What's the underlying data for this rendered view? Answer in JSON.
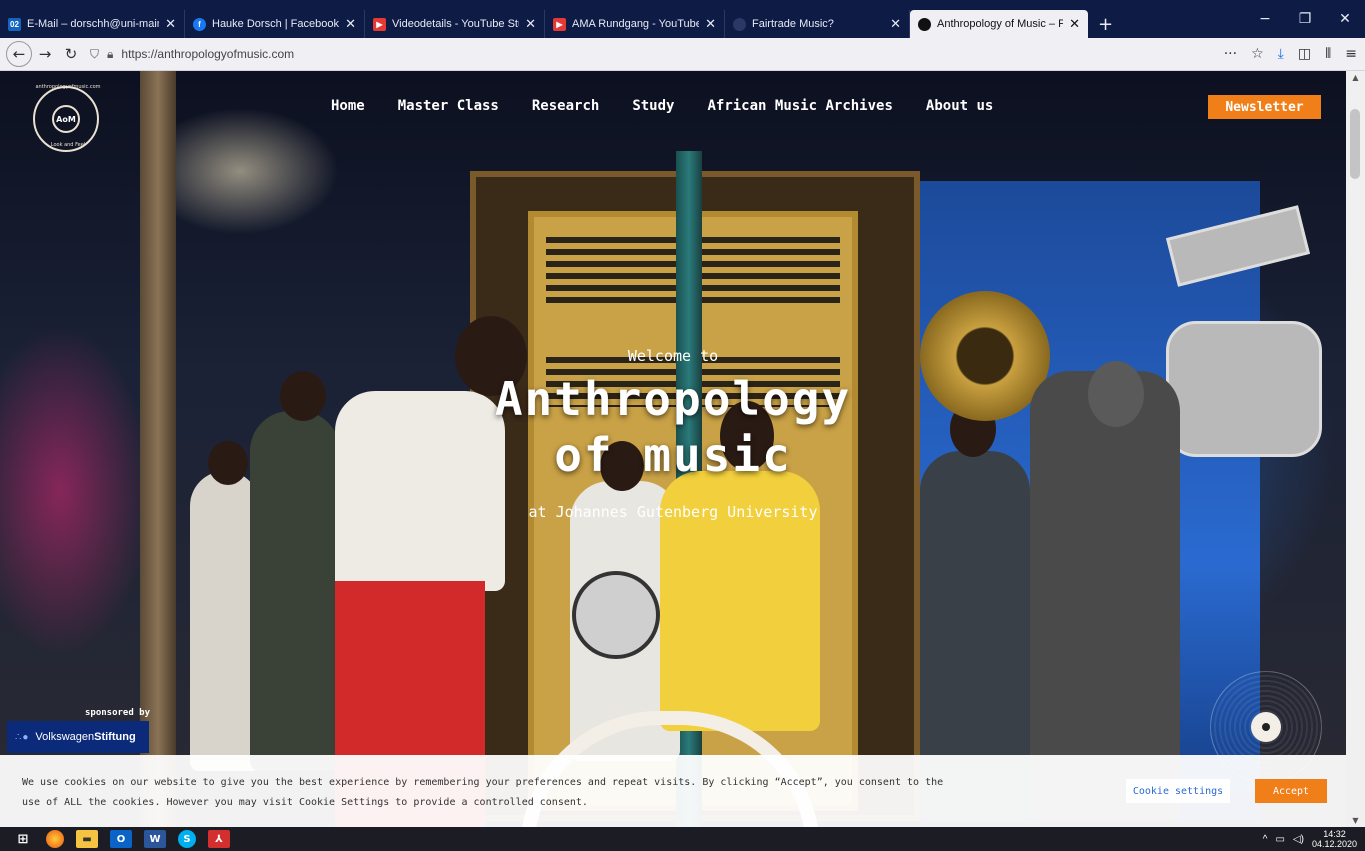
{
  "browser": {
    "tabs": [
      {
        "title": "E-Mail – dorschh@uni-mainz.d",
        "icon": "mail-icon",
        "color": "#1565c0",
        "active": false
      },
      {
        "title": "Hauke Dorsch | Facebook",
        "icon": "facebook-icon",
        "color": "#1877f2",
        "active": false
      },
      {
        "title": "Videodetails - YouTube Studio",
        "icon": "youtube-icon",
        "color": "#e53935",
        "active": false
      },
      {
        "title": "AMA Rundgang - YouTube",
        "icon": "youtube-icon",
        "color": "#e53935",
        "active": false
      },
      {
        "title": "Fairtrade Music?",
        "icon": "globe-icon",
        "color": "#555555",
        "active": false
      },
      {
        "title": "Anthropology of Music – Play",
        "icon": "site-icon",
        "color": "#111111",
        "active": true
      }
    ],
    "url": "https://anthropologyofmusic.com"
  },
  "site": {
    "logo": {
      "ring_top": "anthropologyofmusic.com",
      "center": "AoM",
      "ring_bottom": "Look and Feel"
    },
    "menu": [
      "Home",
      "Master Class",
      "Research",
      "Study",
      "African Music Archives",
      "About us"
    ],
    "newsletter": "Newsletter",
    "welcome": "Welcome to",
    "title_line1": "Anthropology",
    "title_line2": "of music",
    "subtitle": "at Johannes Gutenberg University",
    "sponsor_label": "sponsored by",
    "sponsor_name_a": "Volkswagen",
    "sponsor_name_b": "Stiftung",
    "accent": "#f07f1a"
  },
  "cookie": {
    "text": "We use cookies on our website to give you the best experience by remembering your preferences and repeat visits. By clicking “Accept”, you consent to the use of ALL the cookies. However you may visit Cookie Settings to provide a controlled consent.",
    "settings": "Cookie settings",
    "accept": "Accept"
  },
  "taskbar": {
    "time": "14:32",
    "date": "04.12.2020"
  }
}
